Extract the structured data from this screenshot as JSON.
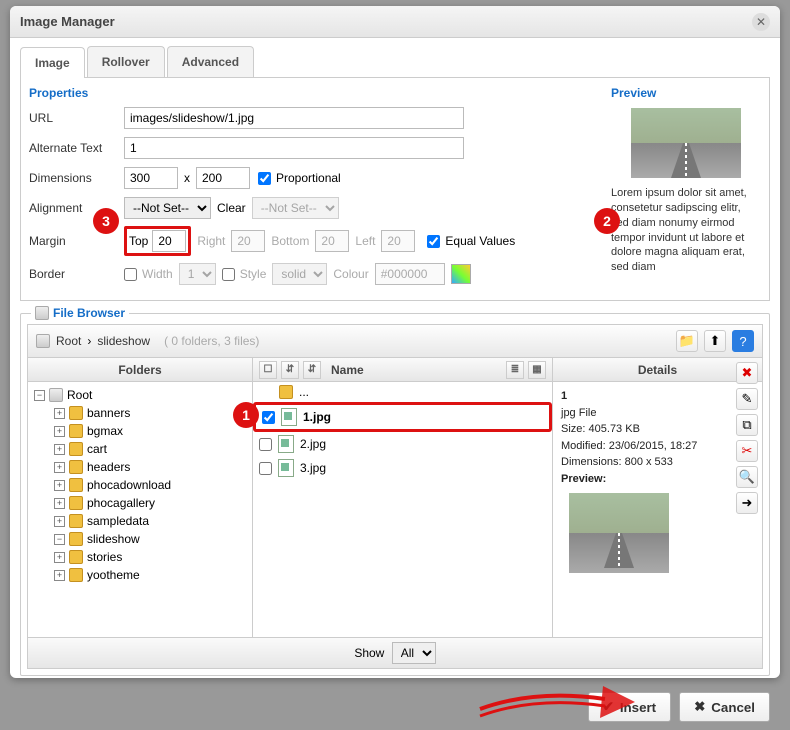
{
  "dialog": {
    "title": "Image Manager"
  },
  "tabs": {
    "image": "Image",
    "rollover": "Rollover",
    "advanced": "Advanced"
  },
  "props": {
    "heading": "Properties",
    "url_label": "URL",
    "url": "images/slideshow/1.jpg",
    "alt_label": "Alternate Text",
    "alt": "1",
    "dim_label": "Dimensions",
    "dim_w": "300",
    "dim_x": "x",
    "dim_h": "200",
    "proportional": "Proportional",
    "align_label": "Alignment",
    "align_value": "--Not Set--",
    "clear_label": "Clear",
    "clear_value": "--Not Set--",
    "margin_label": "Margin",
    "m_top_label": "Top",
    "m_top": "20",
    "m_right_label": "Right",
    "m_right": "20",
    "m_bottom_label": "Bottom",
    "m_bottom": "20",
    "m_left_label": "Left",
    "m_left": "20",
    "equal_label": "Equal Values",
    "border_label": "Border",
    "width_label": "Width",
    "width_val": "1",
    "style_label": "Style",
    "style_val": "solid",
    "colour_label": "Colour",
    "colour_val": "#000000"
  },
  "preview": {
    "heading": "Preview",
    "lorem": "Lorem ipsum dolor sit amet, consetetur sadipscing elitr, sed diam nonumy eirmod tempor invidunt ut labore et dolore magna aliquam erat, sed diam"
  },
  "markers": {
    "m1": "1",
    "m2": "2",
    "m3": "3"
  },
  "fb": {
    "legend": "File Browser",
    "path_root": "Root",
    "path_sep": "›",
    "path_cur": "slideshow",
    "summary": "( 0 folders, 3 files)",
    "col_folders": "Folders",
    "col_name": "Name",
    "col_details": "Details",
    "folders": [
      "banners",
      "bgmax",
      "cart",
      "headers",
      "phocadownload",
      "phocagallery",
      "sampledata",
      "slideshow",
      "stories",
      "yootheme"
    ],
    "up": "...",
    "files": [
      "1.jpg",
      "2.jpg",
      "3.jpg"
    ],
    "show": "Show",
    "show_val": "All"
  },
  "details": {
    "name": "1",
    "type": "jpg File",
    "size_label": "Size:",
    "size": "405.73 KB",
    "mod_label": "Modified:",
    "mod": "23/06/2015, 18:27",
    "dim_label": "Dimensions:",
    "dim": "800 x 533",
    "preview_label": "Preview:"
  },
  "buttons": {
    "insert": "Insert",
    "cancel": "Cancel"
  }
}
